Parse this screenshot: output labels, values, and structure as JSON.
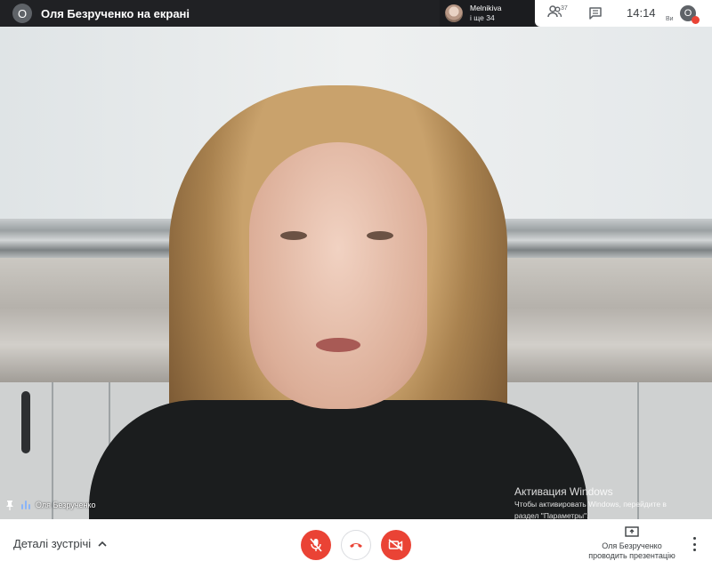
{
  "topbar": {
    "presenter_initial": "О",
    "presenter_text": "Оля Безрученко на екрані",
    "strip_name": "Melnikiva",
    "strip_more": "і ще 34",
    "people_count": "37",
    "time": "14:14",
    "self_label": "Ви",
    "self_initial": "О"
  },
  "video": {
    "speaker_name": "Оля Безрученко",
    "watermark_title": "Активация Windows",
    "watermark_line1": "Чтобы активировать Windows, перейдите в",
    "watermark_line2": "раздел \"Параметры\"."
  },
  "bottombar": {
    "details_label": "Деталі зустрічі",
    "present_line1": "Оля Безрученко",
    "present_line2": "проводить презентацію"
  },
  "icons": {
    "presenter_avatar": "avatar",
    "people": "people-icon",
    "chat": "chat-icon",
    "pin": "pin-icon",
    "audio": "audio-level-icon",
    "mic_off": "mic-off-icon",
    "hang_up": "hang-up-icon",
    "cam_off": "camera-off-icon",
    "present": "present-screen-icon",
    "more": "more-vertical-icon"
  },
  "colors": {
    "danger": "#ea4335",
    "topbar": "#202124",
    "accent": "#8ab4f8"
  }
}
